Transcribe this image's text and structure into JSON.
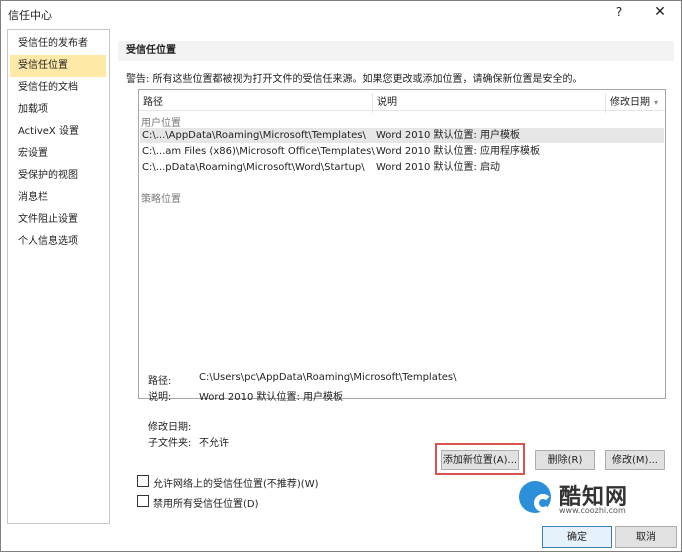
{
  "window": {
    "title": "信任中心",
    "help": "?",
    "close": "✕"
  },
  "sidebar": {
    "items": [
      {
        "label": "受信任的发布者"
      },
      {
        "label": "受信任位置",
        "active": true
      },
      {
        "label": "受信任的文档"
      },
      {
        "label": "加载项"
      },
      {
        "label": "ActiveX 设置"
      },
      {
        "label": "宏设置"
      },
      {
        "label": "受保护的视图"
      },
      {
        "label": "消息栏"
      },
      {
        "label": "文件阻止设置"
      },
      {
        "label": "个人信息选项"
      }
    ]
  },
  "main": {
    "section_title": "受信任位置",
    "warning": "警告: 所有这些位置都被视为打开文件的受信任来源。如果您更改或添加位置，请确保新位置是安全的。",
    "table": {
      "columns": [
        "路径",
        "说明",
        "修改日期"
      ],
      "group_user": "用户位置",
      "group_policy": "策略位置",
      "rows": [
        {
          "path": "C:\\...\\AppData\\Roaming\\Microsoft\\Templates\\",
          "desc": "Word 2010 默认位置: 用户模板",
          "date": ""
        },
        {
          "path": "C:\\...am Files (x86)\\Microsoft Office\\Templates\\",
          "desc": "Word 2010 默认位置: 应用程序模板",
          "date": ""
        },
        {
          "path": "C:\\...pData\\Roaming\\Microsoft\\Word\\Startup\\",
          "desc": "Word 2010 默认位置: 启动",
          "date": ""
        }
      ]
    },
    "details": {
      "path_label": "路径:",
      "path_value": "C:\\Users\\pc\\AppData\\Roaming\\Microsoft\\Templates\\",
      "desc_label": "说明:",
      "desc_value": "Word 2010 默认位置: 用户模板",
      "date_label": "修改日期:",
      "sub_label": "子文件夹:",
      "sub_value": "不允许"
    },
    "buttons": {
      "add": "添加新位置(A)...",
      "remove": "删除(R)",
      "modify": "修改(M)..."
    },
    "checkboxes": {
      "network": "允许网络上的受信任位置(不推荐)(W)",
      "disable_all": "禁用所有受信任位置(D)"
    }
  },
  "footer": {
    "ok": "确定",
    "cancel": "取消"
  },
  "watermark": {
    "brand": "酷知网",
    "url": "www.coozhi.com",
    "color": "#2c8fd9"
  }
}
